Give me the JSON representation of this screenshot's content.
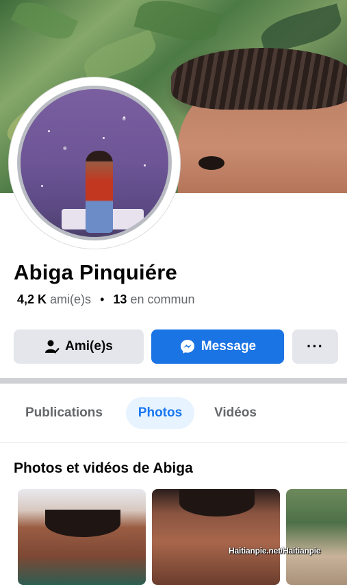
{
  "profile": {
    "name": "Abiga Pinquiére",
    "friends_count": "4,2 K",
    "friends_label": "ami(e)s",
    "separator": "•",
    "mutual_count": "13",
    "mutual_label": "en commun"
  },
  "actions": {
    "friends_button": "Ami(e)s",
    "message_button": "Message",
    "more_button": "···"
  },
  "tabs": [
    {
      "label": "Publications",
      "active": false
    },
    {
      "label": "Photos",
      "active": true
    },
    {
      "label": "Vidéos",
      "active": false
    }
  ],
  "section": {
    "title": "Photos et vidéos de Abiga"
  },
  "watermark": "Haitianpie.net/Haitianpie",
  "colors": {
    "accent": "#1877f2",
    "message_button": "#1b74e4",
    "secondary_button": "#e4e6eb",
    "active_tab_bg": "#e7f3ff"
  },
  "icons": {
    "friends": "person-check-icon",
    "message": "messenger-icon",
    "more": "more-dots-icon"
  }
}
